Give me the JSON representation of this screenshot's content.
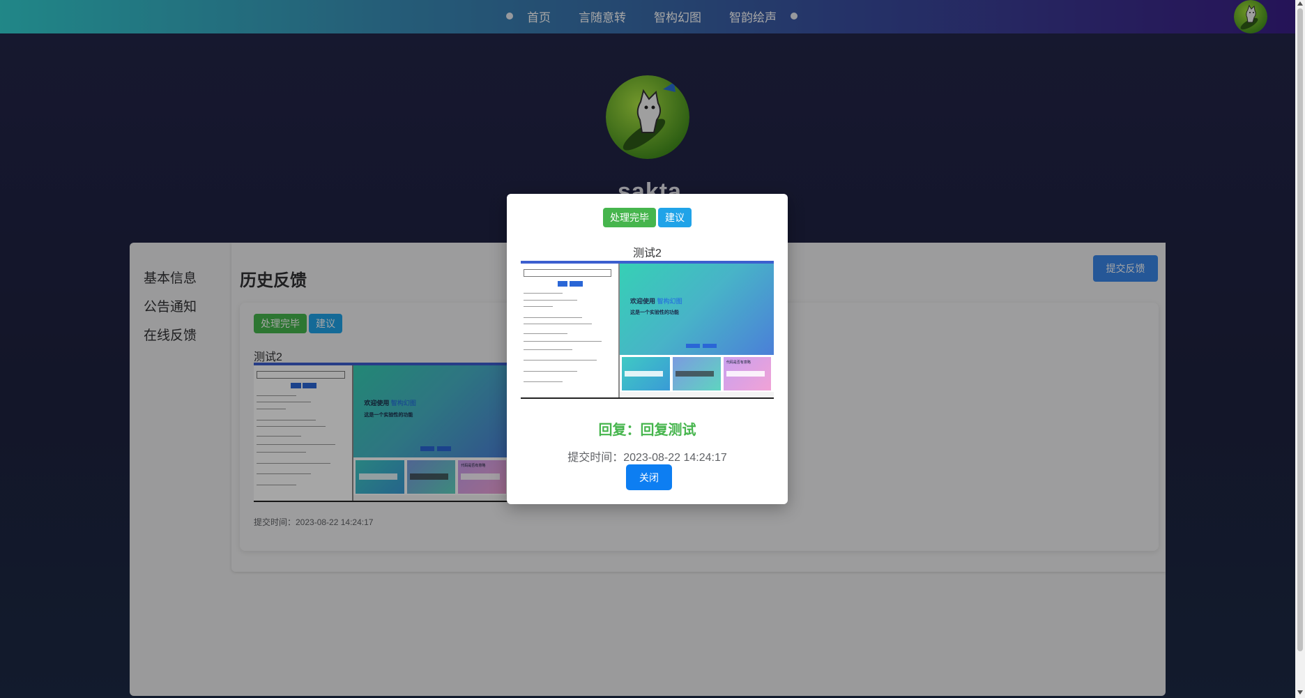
{
  "nav": {
    "items": [
      {
        "label": "首页"
      },
      {
        "label": "言随意转"
      },
      {
        "label": "智构幻图"
      },
      {
        "label": "智韵绘声"
      }
    ]
  },
  "profile": {
    "username": "sakta"
  },
  "sidebar": {
    "items": [
      {
        "label": "基本信息"
      },
      {
        "label": "公告通知"
      },
      {
        "label": "在线反馈"
      }
    ]
  },
  "main": {
    "title": "历史反馈",
    "submit_label": "提交反馈"
  },
  "feedback": {
    "status_tag": "处理完毕",
    "type_tag": "建议",
    "title": "测试2",
    "time_text": "提交时间：2023-08-22 14:24:17",
    "screenshot": {
      "hero_title_prefix": "欢迎使用 ",
      "hero_title_highlight": "智构幻图",
      "hero_subtitle": "这是一个实验性的功能",
      "tile_3_title": "代码是否有意略"
    }
  },
  "modal": {
    "status_tag": "处理完毕",
    "type_tag": "建议",
    "title": "测试2",
    "reply": "回复：回复测试",
    "time_text": "提交时间：2023-08-22 14:24:17",
    "close_label": "关闭"
  },
  "colors": {
    "success": "#46b54d",
    "info": "#20a3e8",
    "primary": "#0d7ef2"
  }
}
